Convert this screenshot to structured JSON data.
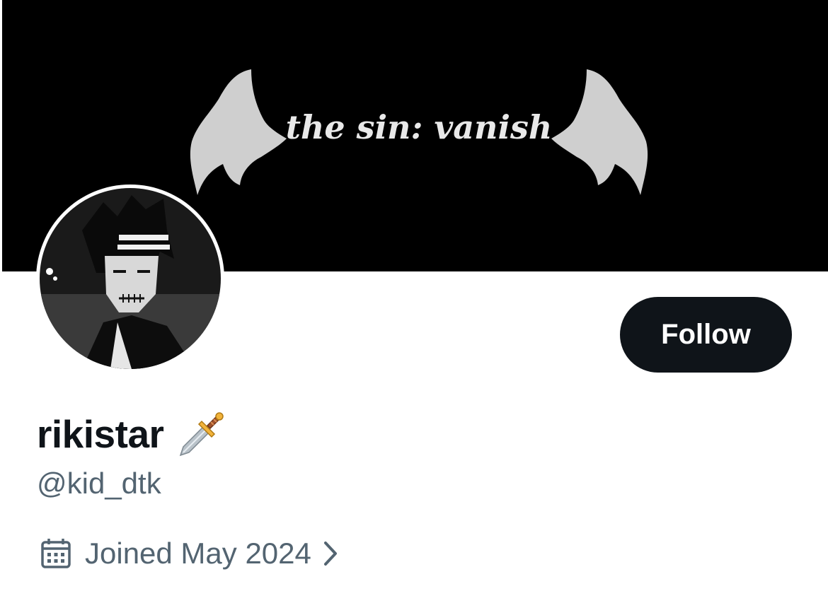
{
  "banner": {
    "text": "the sin: vanish",
    "background_color": "#000000",
    "wing_color": "#cfcfcf"
  },
  "avatar": {
    "description_icon": "anime-character-avatar"
  },
  "follow_button": {
    "label": "Follow",
    "background_color": "#0f1419",
    "text_color": "#ffffff"
  },
  "profile": {
    "display_name": "rikistar",
    "name_emoji_icon": "dagger-icon",
    "handle": "@kid_dtk",
    "joined": "Joined May 2024",
    "joined_icon": "calendar-icon",
    "joined_chevron_icon": "chevron-right-icon",
    "secondary_text_color": "#536471",
    "primary_text_color": "#0f1419"
  }
}
